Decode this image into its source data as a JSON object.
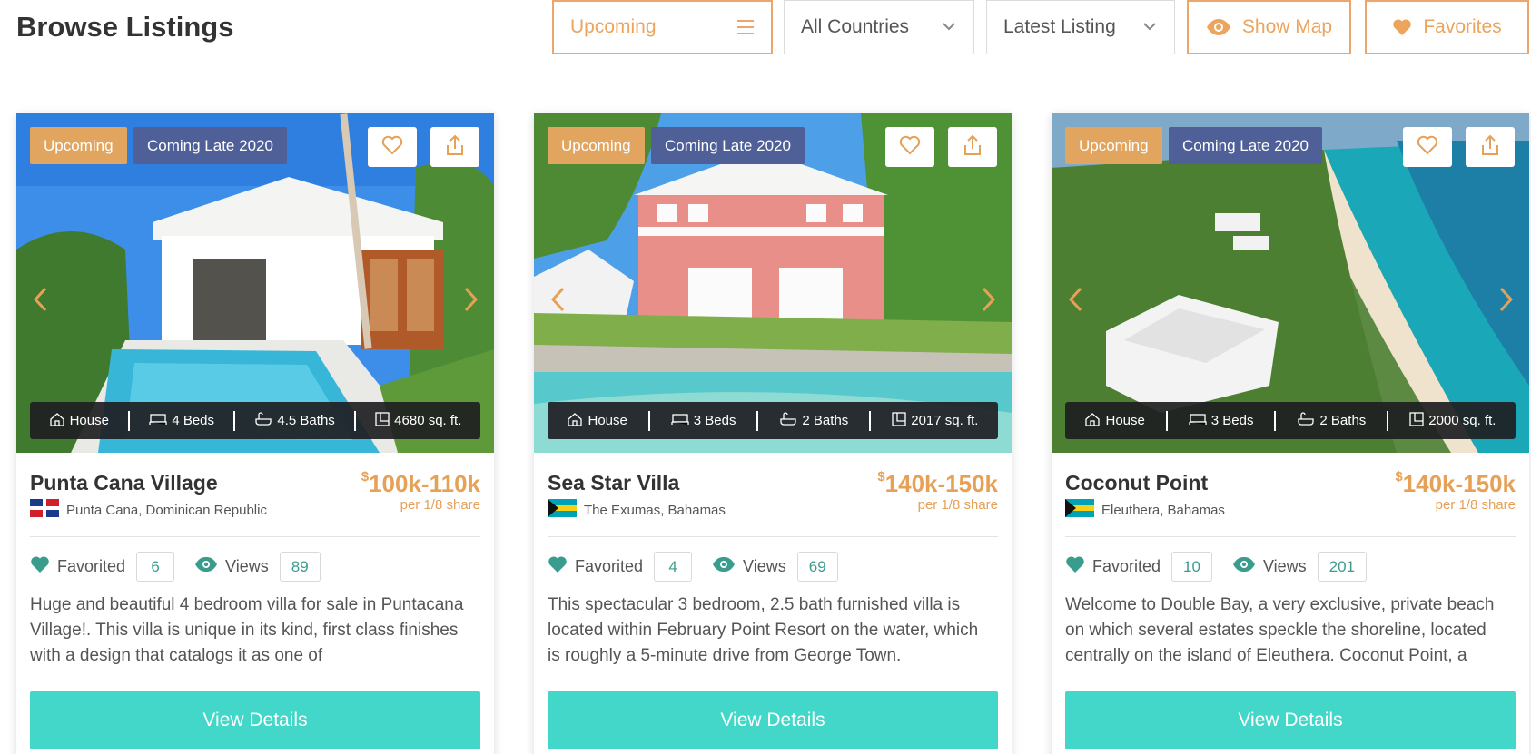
{
  "header": {
    "title": "Browse Listings",
    "status_filter": "Upcoming",
    "country_filter": "All Countries",
    "sort_filter": "Latest Listing",
    "show_map_label": "Show Map",
    "favorites_label": "Favorites"
  },
  "colors": {
    "accent_orange": "#e6a157",
    "badge_navy": "#4f5f98",
    "teal_button": "#43d7c9",
    "teal_icon": "#3a9c8d"
  },
  "listings": [
    {
      "status": "Upcoming",
      "eta": "Coming Late 2020",
      "type": "House",
      "beds": "4 Beds",
      "baths": "4.5 Baths",
      "area": "4680 sq. ft.",
      "name": "Punta Cana Village",
      "location": "Punta Cana, Dominican Republic",
      "flag": "dominican-republic-flag",
      "price_currency": "$",
      "price": "100k-110k",
      "price_note": "per 1/8 share",
      "favorited_label": "Favorited",
      "favorited": "6",
      "views_label": "Views",
      "views": "89",
      "description": "Huge and beautiful 4 bedroom villa for sale in Puntacana Village!. This villa is unique in its kind, first class finishes with a design that catalogs it as one of",
      "cta": "View Details"
    },
    {
      "status": "Upcoming",
      "eta": "Coming Late 2020",
      "type": "House",
      "beds": "3 Beds",
      "baths": "2 Baths",
      "area": "2017 sq. ft.",
      "name": "Sea Star Villa",
      "location": "The Exumas, Bahamas",
      "flag": "bahamas-flag",
      "price_currency": "$",
      "price": "140k-150k",
      "price_note": "per 1/8 share",
      "favorited_label": "Favorited",
      "favorited": "4",
      "views_label": "Views",
      "views": "69",
      "description": "This spectacular 3 bedroom, 2.5 bath furnished villa is located within February Point Resort on the water, which is roughly a 5-minute drive from George Town.",
      "cta": "View Details"
    },
    {
      "status": "Upcoming",
      "eta": "Coming Late 2020",
      "type": "House",
      "beds": "3 Beds",
      "baths": "2 Baths",
      "area": "2000 sq. ft.",
      "name": "Coconut Point",
      "location": "Eleuthera, Bahamas",
      "flag": "bahamas-flag",
      "price_currency": "$",
      "price": "140k-150k",
      "price_note": "per 1/8 share",
      "favorited_label": "Favorited",
      "favorited": "10",
      "views_label": "Views",
      "views": "201",
      "description": "Welcome to Double Bay, a very exclusive, private beach on which several estates speckle the shoreline, located centrally on the island of Eleuthera. Coconut Point, a",
      "cta": "View Details"
    }
  ]
}
